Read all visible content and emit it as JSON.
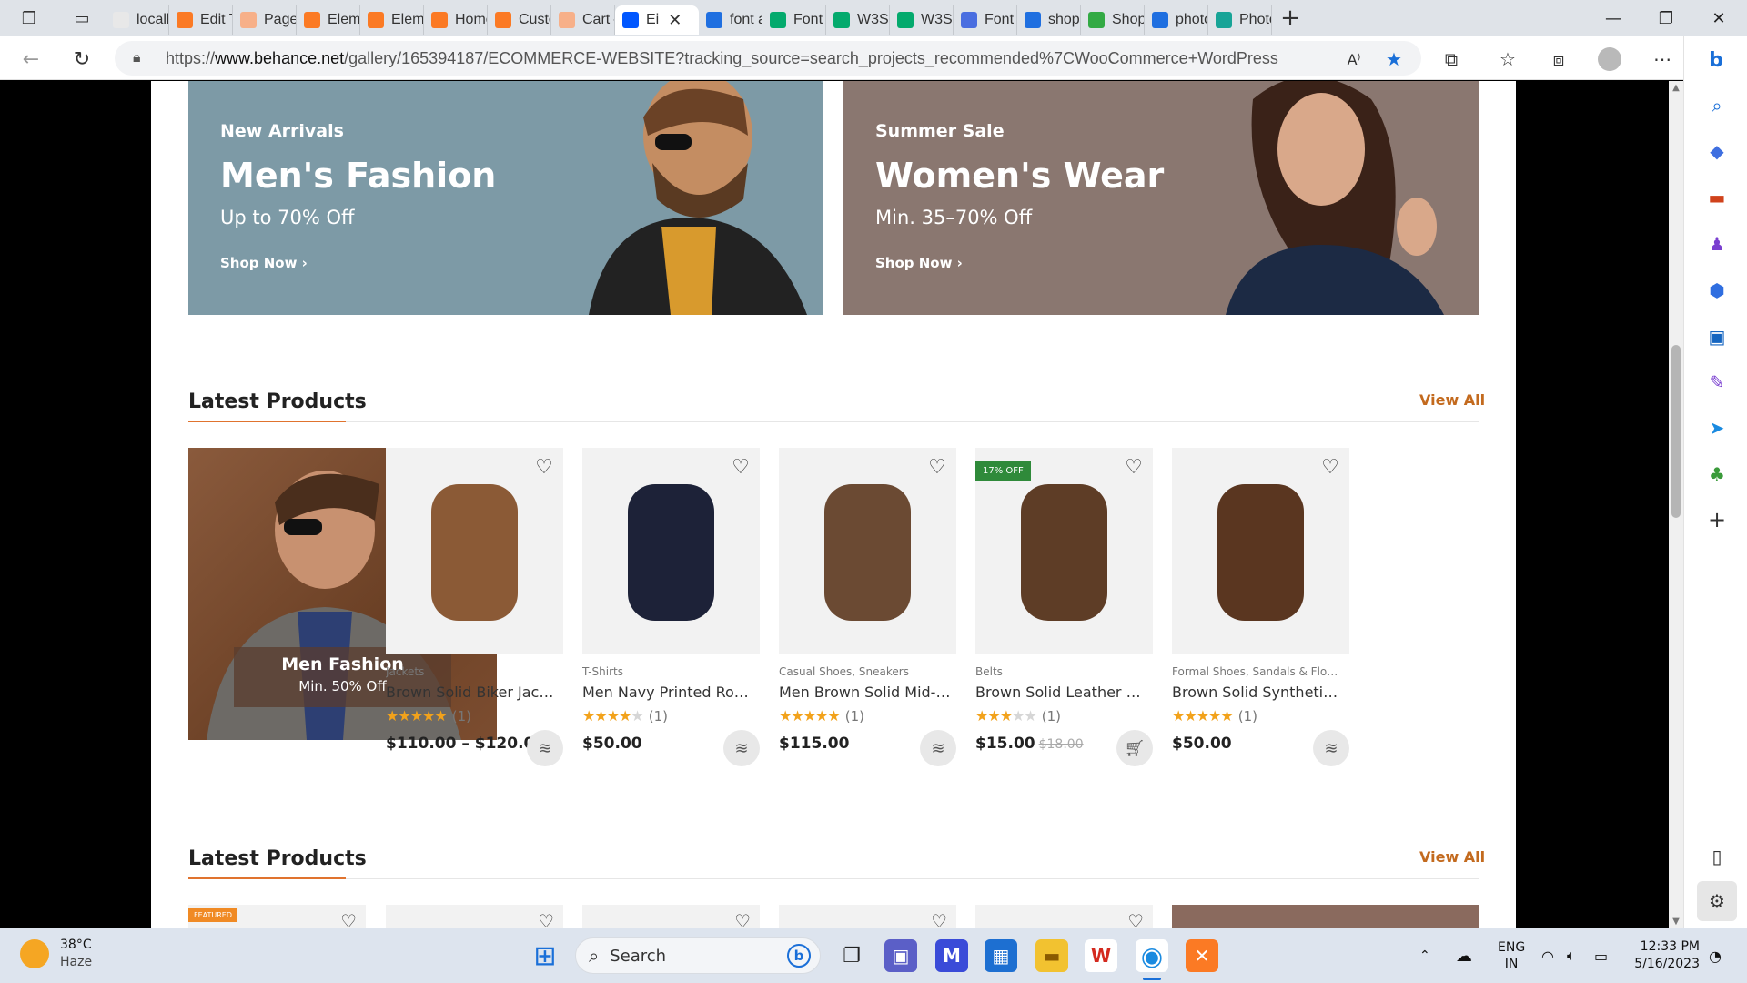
{
  "browser": {
    "tabs": [
      {
        "label": "localh",
        "favicon": "pma-icon",
        "color": "#e8e8e8"
      },
      {
        "label": "Edit Tl",
        "favicon": "xampp-icon",
        "color": "#fb7a24"
      },
      {
        "label": "Pages",
        "favicon": "xampp-icon",
        "color": "#f7b089"
      },
      {
        "label": "Eleme",
        "favicon": "xampp-icon",
        "color": "#fb7a24"
      },
      {
        "label": "Eleme",
        "favicon": "xampp-icon",
        "color": "#fb7a24"
      },
      {
        "label": "Home",
        "favicon": "xampp-icon",
        "color": "#fb7a24"
      },
      {
        "label": "Custo",
        "favicon": "xampp-icon",
        "color": "#fb7a24"
      },
      {
        "label": "Cart –",
        "favicon": "xampp-icon",
        "color": "#f7b089"
      },
      {
        "label": "Ei",
        "favicon": "behance-icon",
        "color": "#0057ff",
        "active": true
      },
      {
        "label": "font a",
        "favicon": "search-icon",
        "color": "#1f6fe0"
      },
      {
        "label": "Font /",
        "favicon": "w3-icon",
        "color": "#04aa6d"
      },
      {
        "label": "W3Sc",
        "favicon": "w3-icon",
        "color": "#04aa6d"
      },
      {
        "label": "W3Sc",
        "favicon": "w3-icon",
        "color": "#04aa6d"
      },
      {
        "label": "Font /",
        "favicon": "flag-icon",
        "color": "#4a6ee0"
      },
      {
        "label": "shopp",
        "favicon": "search-icon",
        "color": "#1f6fe0"
      },
      {
        "label": "Shop",
        "favicon": "shopify-icon",
        "color": "#33aa44"
      },
      {
        "label": "photo",
        "favicon": "search-icon",
        "color": "#1f6fe0"
      },
      {
        "label": "Photo",
        "favicon": "photopea-icon",
        "color": "#18a497"
      }
    ],
    "url_prefix": "https://",
    "url_host": "www.behance.net",
    "url_path": "/gallery/165394187/ECOMMERCE-WEBSITE?tracking_source=search_projects_recommended%7CWooCommerce+WordPress"
  },
  "banners": [
    {
      "kicker": "New Arrivals",
      "headline": "Men's Fashion",
      "sub": "Up to 70% Off",
      "cta": "Shop Now ›",
      "color": "#7d9aa6"
    },
    {
      "kicker": "Summer Sale",
      "headline": "Women's Wear",
      "sub": "Min. 35–70% Off",
      "cta": "Shop Now ›",
      "color": "#8a7770"
    }
  ],
  "latest": {
    "title": "Latest Products",
    "view_all": "View All",
    "promo": {
      "title": "Men Fashion",
      "sub": "Min. 50% Off"
    },
    "products": [
      {
        "category": "Jackets",
        "name": "Brown Solid Biker Jack…",
        "rating": 5,
        "count": "(1)",
        "price": "$110.00 – $120.00",
        "old_price": "",
        "action": "layers-icon",
        "badge": ""
      },
      {
        "category": "T-Shirts",
        "name": "Men Navy Printed Rou…",
        "rating": 4,
        "count": "(1)",
        "price": "$50.00",
        "old_price": "",
        "action": "layers-icon",
        "badge": ""
      },
      {
        "category": "Casual Shoes, Sneakers",
        "name": "Men Brown Solid Mid-…",
        "rating": 5,
        "count": "(1)",
        "price": "$115.00",
        "old_price": "",
        "action": "layers-icon",
        "badge": ""
      },
      {
        "category": "Belts",
        "name": "Brown Solid Leather B…",
        "rating": 3,
        "count": "(1)",
        "price": "$15.00",
        "old_price": "$18.00",
        "action": "cart-icon",
        "badge": "17% OFF"
      },
      {
        "category": "Formal Shoes, Sandals & Flo…",
        "name": "Brown Solid Synthetic …",
        "rating": 5,
        "count": "(1)",
        "price": "$50.00",
        "old_price": "",
        "action": "layers-icon",
        "badge": ""
      }
    ]
  },
  "latest2": {
    "title": "Latest Products",
    "view_all": "View All",
    "badge": "FEATURED"
  },
  "taskbar": {
    "temp": "38°C",
    "weather": "Haze",
    "search_placeholder": "Search",
    "lang1": "ENG",
    "lang2": "IN",
    "time": "12:33 PM",
    "date": "5/16/2023"
  }
}
